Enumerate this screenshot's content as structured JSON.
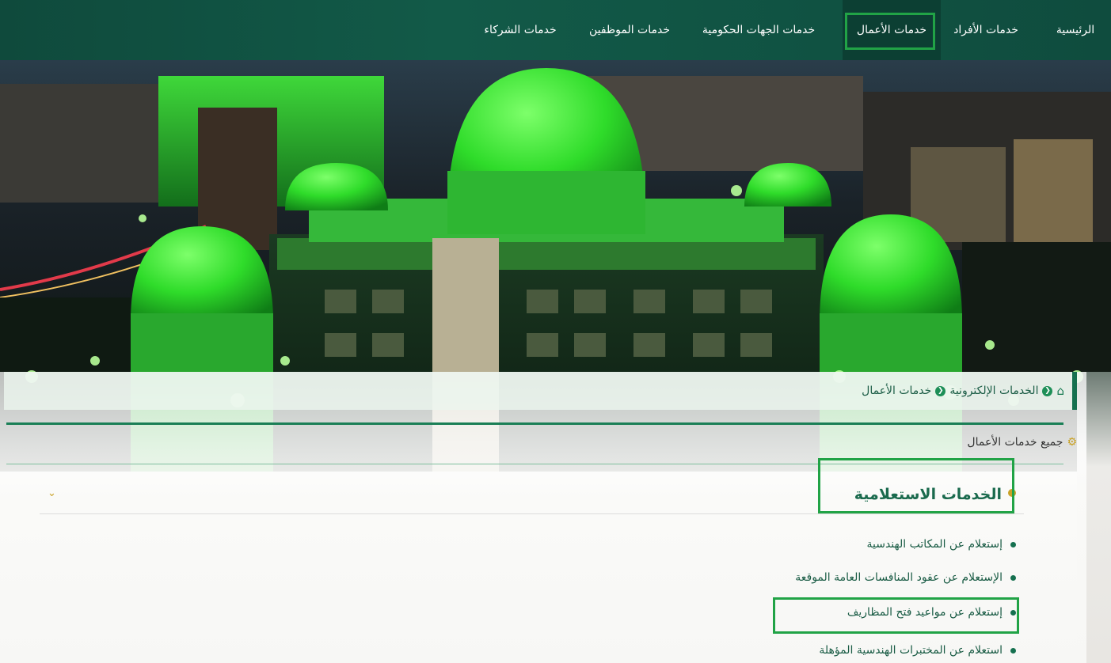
{
  "nav": {
    "items": [
      {
        "label": "الرئيسية"
      },
      {
        "label": "خدمات الأفراد"
      },
      {
        "label": "خدمات الأعمال",
        "active": true
      },
      {
        "label": "خدمات الجهات الحكومية"
      },
      {
        "label": "خدمات الموظفين"
      },
      {
        "label": "خدمات الشركاء"
      }
    ]
  },
  "breadcrumb": {
    "home_icon": "home-icon",
    "items": [
      {
        "label": "الخدمات الإلكترونية"
      },
      {
        "label": "خدمات الأعمال"
      }
    ]
  },
  "section": {
    "icon": "gears-icon",
    "title": "جميع خدمات الأعمال"
  },
  "accordion": {
    "title": "الخدمات الاستعلامية",
    "chevron": "chevron-down-icon"
  },
  "services": [
    {
      "label": "إستعلام عن المكاتب الهندسية"
    },
    {
      "label": "الإستعلام عن عقود المنافسات العامة الموقعة"
    },
    {
      "label": "إستعلام عن مواعيد فتح المظاريف"
    },
    {
      "label": "استعلام عن المختبرات الهندسية المؤهلة"
    }
  ],
  "colors": {
    "nav_bg": "#125a48",
    "brand_green": "#15704f",
    "highlight": "#21a346",
    "accent_gold": "#c9a227"
  }
}
